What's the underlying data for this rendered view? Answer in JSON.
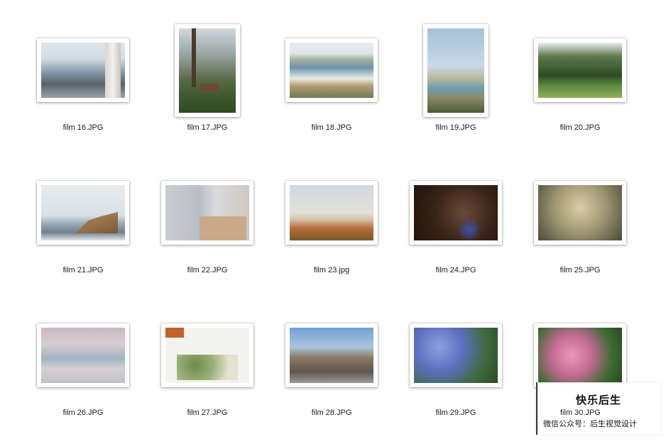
{
  "files": [
    {
      "name": "film 16.JPG",
      "orientation": "land"
    },
    {
      "name": "film 17.JPG",
      "orientation": "port"
    },
    {
      "name": "film 18.JPG",
      "orientation": "land"
    },
    {
      "name": "film 19.JPG",
      "orientation": "port"
    },
    {
      "name": "film 20.JPG",
      "orientation": "land"
    },
    {
      "name": "film 21.JPG",
      "orientation": "land"
    },
    {
      "name": "film 22.JPG",
      "orientation": "land"
    },
    {
      "name": "film 23.jpg",
      "orientation": "land"
    },
    {
      "name": "film 24.JPG",
      "orientation": "land"
    },
    {
      "name": "film 25.JPG",
      "orientation": "land"
    },
    {
      "name": "film 26.JPG",
      "orientation": "land"
    },
    {
      "name": "film 27.JPG",
      "orientation": "land"
    },
    {
      "name": "film 28.JPG",
      "orientation": "land"
    },
    {
      "name": "film 29.JPG",
      "orientation": "land"
    },
    {
      "name": "film 30.JPG",
      "orientation": "land"
    }
  ],
  "watermark": {
    "title": "快乐后生",
    "subtitle": "微信公众号：后生视觉设计"
  }
}
